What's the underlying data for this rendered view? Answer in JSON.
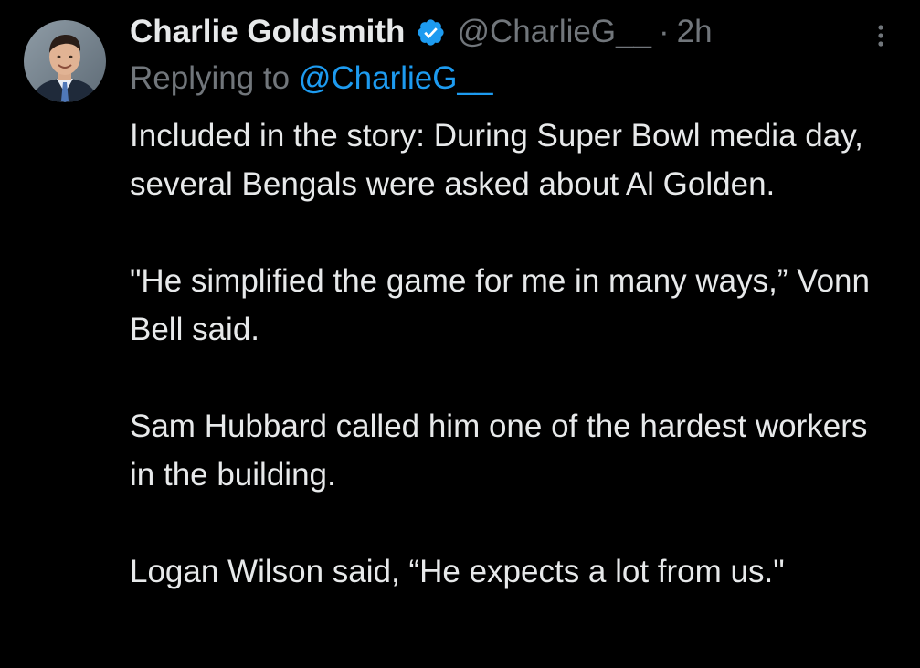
{
  "tweet": {
    "author": {
      "display_name": "Charlie Goldsmith",
      "handle": "@CharlieG__",
      "verified": true,
      "avatar_icon": "profile-photo"
    },
    "separator": "·",
    "time": "2h",
    "replying_to_label": "Replying to",
    "replying_to_handle": "@CharlieG__",
    "body": [
      "Included in the story: During Super Bowl media day, several Bengals were asked about Al Golden.",
      "\"He simplified the game for me in many ways,” Vonn Bell said.",
      "Sam Hubbard called him one of the hardest workers in the building.",
      "Logan Wilson said, “He expects a lot from us.\""
    ]
  },
  "icons": {
    "verified": "verified-badge-icon",
    "more": "more-options-icon"
  },
  "colors": {
    "background": "#000000",
    "primary_text": "#e7e9ea",
    "secondary_text": "#71767b",
    "accent": "#1d9bf0"
  }
}
